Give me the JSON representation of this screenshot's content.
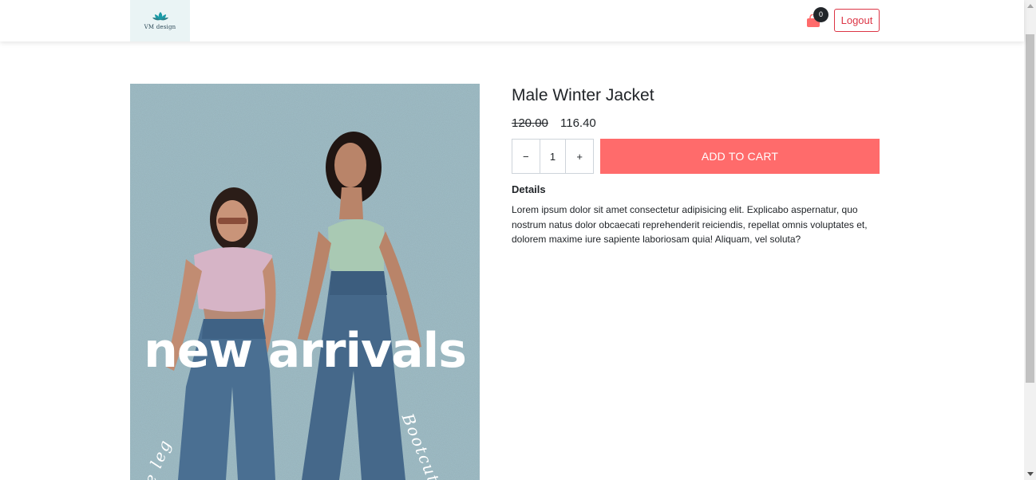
{
  "header": {
    "logo_text": "VM design",
    "cart_count": "0",
    "logout_label": "Logout"
  },
  "product": {
    "name": "Male Winter Jacket",
    "old_price": "120.00",
    "new_price": "116.40",
    "quantity": "1",
    "decrement_label": "−",
    "increment_label": "+",
    "add_to_cart_label": "ADD TO CART",
    "details_heading": "Details",
    "details_text": "Lorem ipsum dolor sit amet consectetur adipisicing elit. Explicabo aspernatur, quo nostrum natus dolor obcaecati reprehenderit reiciendis, repellat omnis voluptates et, dolorem maxime iure sapiente laboriosam quia! Aliquam, vel soluta?"
  },
  "promo_image": {
    "headline": "new arrivals",
    "side_text_right": "Bootcut",
    "side_text_left": "e leg"
  },
  "colors": {
    "accent": "#ff6b6b",
    "logout": "#dc3545",
    "cart_icon": "#ff6b6b",
    "logo": "#1a9aa6"
  },
  "icons": {
    "cart": "shopping-bag-icon",
    "logo": "lotus-icon"
  }
}
